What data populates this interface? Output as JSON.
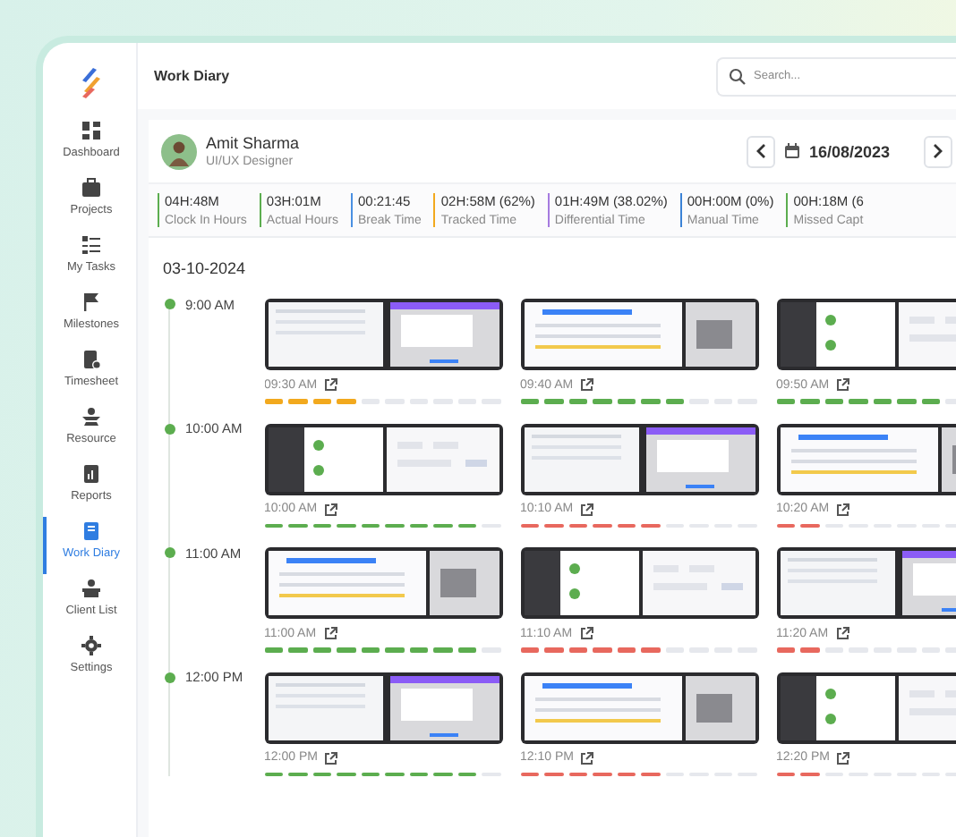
{
  "sidebar": {
    "items": [
      {
        "label": "Dashboard",
        "selected": false
      },
      {
        "label": "Projects",
        "selected": false
      },
      {
        "label": "My Tasks",
        "selected": false
      },
      {
        "label": "Milestones",
        "selected": false
      },
      {
        "label": "Timesheet",
        "selected": false
      },
      {
        "label": "Resource",
        "selected": false
      },
      {
        "label": "Reports",
        "selected": false
      },
      {
        "label": "Work Diary",
        "selected": true
      },
      {
        "label": "Client List",
        "selected": false
      },
      {
        "label": "Settings",
        "selected": false
      }
    ]
  },
  "header": {
    "title": "Work Diary",
    "search": {
      "placeholder": "Search..."
    }
  },
  "user": {
    "name": "Amit Sharma",
    "role": "UI/UX Designer"
  },
  "date_nav": {
    "date": "16/08/2023"
  },
  "stats": [
    {
      "value": "04H:48M",
      "label": "Clock In Hours",
      "color": "#5cad4f"
    },
    {
      "value": "03H:01M",
      "label": "Actual Hours",
      "color": "#5cad4f"
    },
    {
      "value": "00:21:45",
      "label": "Break Time",
      "color": "#4a90e2"
    },
    {
      "value": "02H:58M (62%)",
      "label": "Tracked Time",
      "color": "#f2a91e"
    },
    {
      "value": "01H:49M (38.02%)",
      "label": "Differential Time",
      "color": "#a67be0"
    },
    {
      "value": "00H:00M (0%)",
      "label": "Manual Time",
      "color": "#3b82d6"
    },
    {
      "value": "00H:18M (6",
      "label": "Missed Capt",
      "color": "#5cad4f"
    }
  ],
  "day": "03-10-2024",
  "hours": [
    {
      "time": "9:00 AM",
      "captures": [
        {
          "time": "09:30 AM",
          "level": 0.4,
          "color": "#f2a91e"
        },
        {
          "time": "09:40 AM",
          "level": 0.7,
          "color": "#5cad4f"
        },
        {
          "time": "09:50 AM",
          "level": 0.7,
          "color": "#5cad4f"
        }
      ]
    },
    {
      "time": "10:00 AM",
      "captures": [
        {
          "time": "10:00 AM",
          "level": 0.9,
          "color": "#5cad4f"
        },
        {
          "time": "10:10 AM",
          "level": 0.6,
          "color": "#e8685e"
        },
        {
          "time": "10:20 AM",
          "level": 0.2,
          "color": "#e8685e"
        }
      ]
    },
    {
      "time": "11:00 AM",
      "captures": [
        {
          "time": "11:00 AM",
          "level": 0.9,
          "color": "#5cad4f"
        },
        {
          "time": "11:10 AM",
          "level": 0.6,
          "color": "#e8685e"
        },
        {
          "time": "11:20 AM",
          "level": 0.2,
          "color": "#e8685e"
        }
      ]
    },
    {
      "time": "12:00 PM",
      "captures": [
        {
          "time": "12:00 PM",
          "level": 0.9,
          "color": "#5cad4f"
        },
        {
          "time": "12:10 PM",
          "level": 0.6,
          "color": "#e8685e"
        },
        {
          "time": "12:20 PM",
          "level": 0.2,
          "color": "#e8685e"
        }
      ]
    }
  ]
}
